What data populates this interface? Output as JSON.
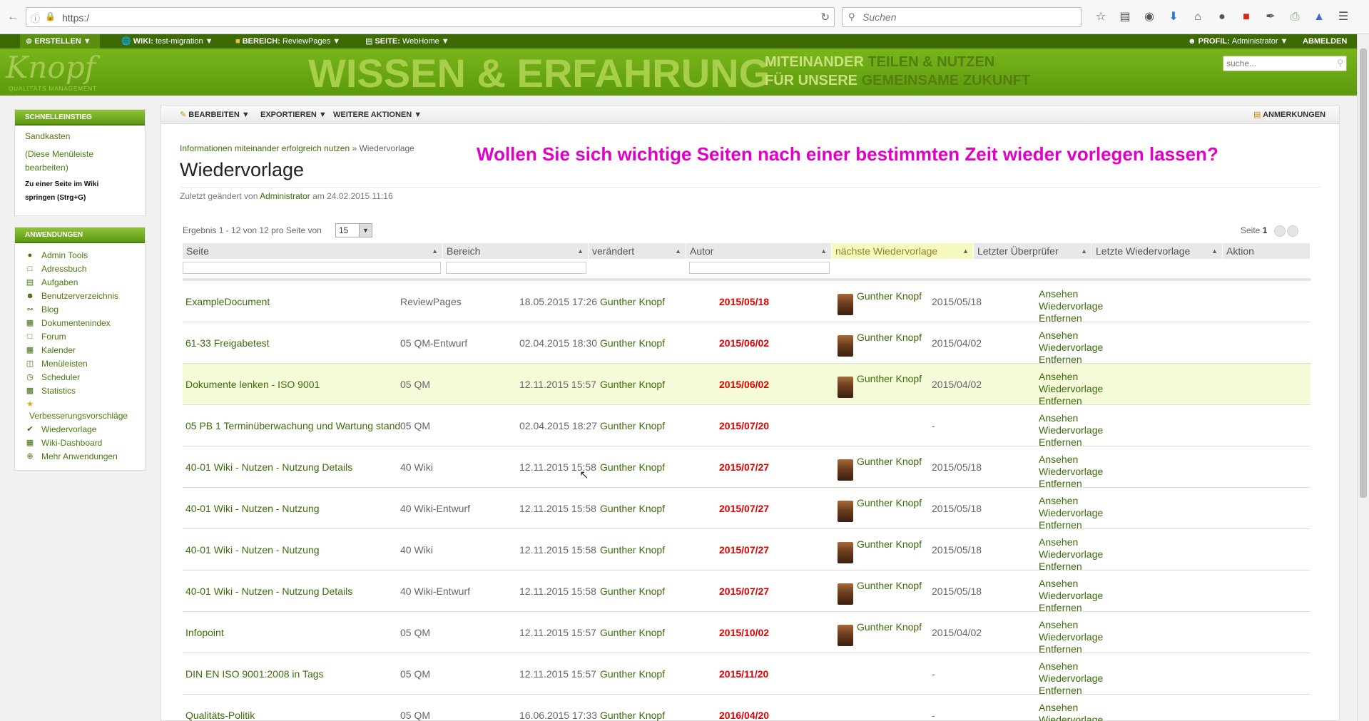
{
  "browser": {
    "url": "https:/",
    "search_placeholder": "Suchen"
  },
  "topbar": {
    "create": "ERSTELLEN",
    "wiki_label": "WIKI:",
    "wiki_value": "test-migration",
    "area_label": "BEREICH:",
    "area_value": "ReviewPages",
    "page_label": "SEITE:",
    "page_value": "WebHome",
    "profile_label": "PROFIL:",
    "profile_value": "Administrator",
    "logout": "ABMELDEN"
  },
  "banner": {
    "logo": "Knopf",
    "logo_sub": "QUALITÄTS MANAGEMENT",
    "headline": "WISSEN & ERFAHRUNG",
    "line1_a": "MITEINANDER",
    "line1_b": "TEILEN & NUTZEN",
    "line2_a": "FÜR UNSERE",
    "line2_b": "GEMEINSAME ZUKUNFT",
    "search_placeholder": "suche..."
  },
  "sidebar": {
    "quick_title": "SCHNELLEINSTIEG",
    "quick_items": [
      "Sandkasten",
      "(Diese Menüleiste",
      "bearbeiten)"
    ],
    "quick_jump_1": "Zu einer Seite im Wiki",
    "quick_jump_2": "springen (Strg+G)",
    "apps_title": "ANWENDUNGEN",
    "apps": [
      {
        "label": "Admin Tools",
        "icon": "globe-icon"
      },
      {
        "label": "Adressbuch",
        "icon": "addressbook-icon"
      },
      {
        "label": "Aufgaben",
        "icon": "tasks-icon"
      },
      {
        "label": "Benutzerverzeichnis",
        "icon": "users-icon"
      },
      {
        "label": "Blog",
        "icon": "rss-icon"
      },
      {
        "label": "Dokumentenindex",
        "icon": "document-icon"
      },
      {
        "label": "Forum",
        "icon": "forum-icon"
      },
      {
        "label": "Kalender",
        "icon": "calendar-icon"
      },
      {
        "label": "Menüleisten",
        "icon": "menu-icon"
      },
      {
        "label": "Scheduler",
        "icon": "clock-icon"
      },
      {
        "label": "Statistics",
        "icon": "chart-icon"
      },
      {
        "label": "Verbesserungsvorschläge",
        "icon": "star-icon"
      },
      {
        "label": "Wiedervorlage",
        "icon": "check-icon"
      },
      {
        "label": "Wiki-Dashboard",
        "icon": "dashboard-icon"
      },
      {
        "label": "Mehr Anwendungen",
        "icon": "plus-icon"
      }
    ]
  },
  "actionbar": {
    "edit": "BEARBEITEN",
    "export": "EXPORTIEREN",
    "more": "WEITERE AKTIONEN",
    "comments": "ANMERKUNGEN"
  },
  "page": {
    "breadcrumb_link": "Informationen miteinander erfolgreich nutzen",
    "breadcrumb_sep": " » ",
    "breadcrumb_current": "Wiedervorlage",
    "title": "Wiedervorlage",
    "promo": "Wollen Sie sich wichtige Seiten nach einer bestimmten Zeit wieder vorlegen lassen?",
    "modified_prefix": "Zuletzt geändert von",
    "modified_author": "Administrator",
    "modified_suffix": "am 24.02.2015 11:16"
  },
  "table": {
    "results_text": "Ergebnis 1 - 12 von 12",
    "per_page_text": "pro Seite von",
    "per_page_value": "15",
    "page_label": "Seite",
    "page_number": "1",
    "headers": [
      "Seite",
      "Bereich",
      "verändert",
      "Autor",
      "nächste Wiedervorlage",
      "Letzter Überprüfer",
      "Letzte Wiedervorlage",
      "Aktion"
    ],
    "actions": [
      "Ansehen",
      "Wiedervorlage",
      "Entfernen"
    ],
    "rows": [
      {
        "page": "ExampleDocument",
        "area": "ReviewPages",
        "changed": "18.05.2015 17:26",
        "author": "Gunther Knopf",
        "next": "2015/05/18",
        "reviewer": "Gunther Knopf",
        "last": "2015/05/18"
      },
      {
        "page": "61-33 Freigabetest",
        "area": "05 QM-Entwurf",
        "changed": "02.04.2015 18:30",
        "author": "Gunther Knopf",
        "next": "2015/06/02",
        "reviewer": "Gunther Knopf",
        "last": "2015/04/02"
      },
      {
        "page": "Dokumente lenken - ISO 9001",
        "area": "05 QM",
        "changed": "12.11.2015 15:57",
        "author": "Gunther Knopf",
        "next": "2015/06/02",
        "reviewer": "Gunther Knopf",
        "last": "2015/04/02"
      },
      {
        "page": "05 PB 1 Terminüberwachung und Wartung stand",
        "area": "05 QM",
        "changed": "02.04.2015 18:27",
        "author": "Gunther Knopf",
        "next": "2015/07/20",
        "reviewer": "",
        "last": "-"
      },
      {
        "page": "40-01 Wiki - Nutzen - Nutzung Details",
        "area": "40 Wiki",
        "changed": "12.11.2015 15:58",
        "author": "Gunther Knopf",
        "next": "2015/07/27",
        "reviewer": "Gunther Knopf",
        "last": "2015/05/18"
      },
      {
        "page": "40-01 Wiki - Nutzen - Nutzung",
        "area": "40 Wiki-Entwurf",
        "changed": "12.11.2015 15:58",
        "author": "Gunther Knopf",
        "next": "2015/07/27",
        "reviewer": "Gunther Knopf",
        "last": "2015/05/18"
      },
      {
        "page": "40-01 Wiki - Nutzen - Nutzung",
        "area": "40 Wiki",
        "changed": "12.11.2015 15:58",
        "author": "Gunther Knopf",
        "next": "2015/07/27",
        "reviewer": "Gunther Knopf",
        "last": "2015/05/18"
      },
      {
        "page": "40-01 Wiki - Nutzen - Nutzung Details",
        "area": "40 Wiki-Entwurf",
        "changed": "12.11.2015 15:58",
        "author": "Gunther Knopf",
        "next": "2015/07/27",
        "reviewer": "Gunther Knopf",
        "last": "2015/05/18"
      },
      {
        "page": "Infopoint",
        "area": "05 QM",
        "changed": "12.11.2015 15:57",
        "author": "Gunther Knopf",
        "next": "2015/10/02",
        "reviewer": "Gunther Knopf",
        "last": "2015/04/02"
      },
      {
        "page": "DIN EN ISO 9001:2008 in Tags",
        "area": "05 QM",
        "changed": "12.11.2015 15:57",
        "author": "Gunther Knopf",
        "next": "2015/11/20",
        "reviewer": "",
        "last": "-"
      },
      {
        "page": "Qualitäts-Politik",
        "area": "05 QM",
        "changed": "16.06.2015 17:33",
        "author": "Gunther Knopf",
        "next": "2016/04/20",
        "reviewer": "",
        "last": "-"
      }
    ]
  },
  "colors": {
    "accent_green": "#3d6d0a",
    "due_red": "#e00000",
    "promo_magenta": "#e000c8",
    "highlight_header": "#f7f7c0",
    "hover_row": "#f5fbd8"
  }
}
